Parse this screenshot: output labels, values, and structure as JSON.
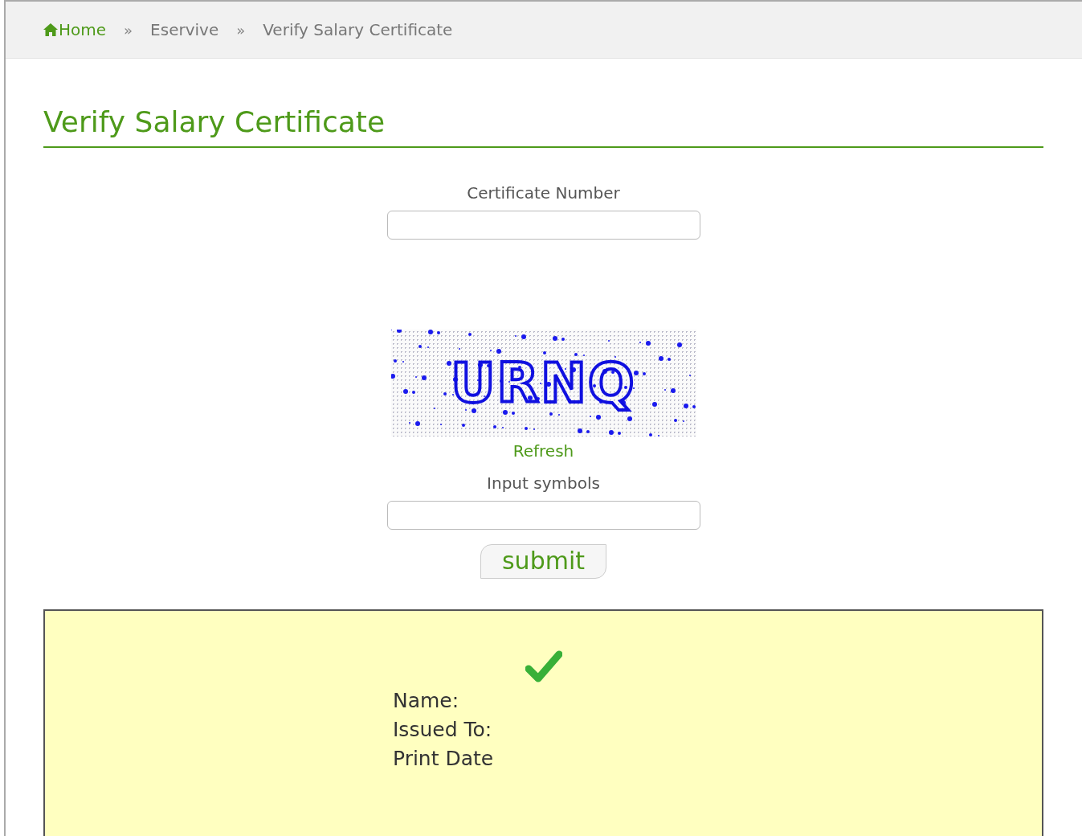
{
  "breadcrumb": [
    {
      "label": "Home",
      "kind": "home"
    },
    {
      "label": "»",
      "kind": "separator"
    },
    {
      "label": "Eservive",
      "kind": "crumb"
    },
    {
      "label": "»",
      "kind": "separator"
    },
    {
      "label": "Verify Salary Certificate",
      "kind": "crumb"
    }
  ],
  "title": "Verify Salary Certificate",
  "certificate_field": {
    "label": "Certificate Number"
  },
  "captcha": {
    "text": "URNQ",
    "refresh": "Refresh"
  },
  "symbols_field": {
    "label": "Input symbols"
  },
  "submit": "submit",
  "result": {
    "lines": [
      "Name:",
      "Issued To:",
      "Print Date"
    ]
  }
}
